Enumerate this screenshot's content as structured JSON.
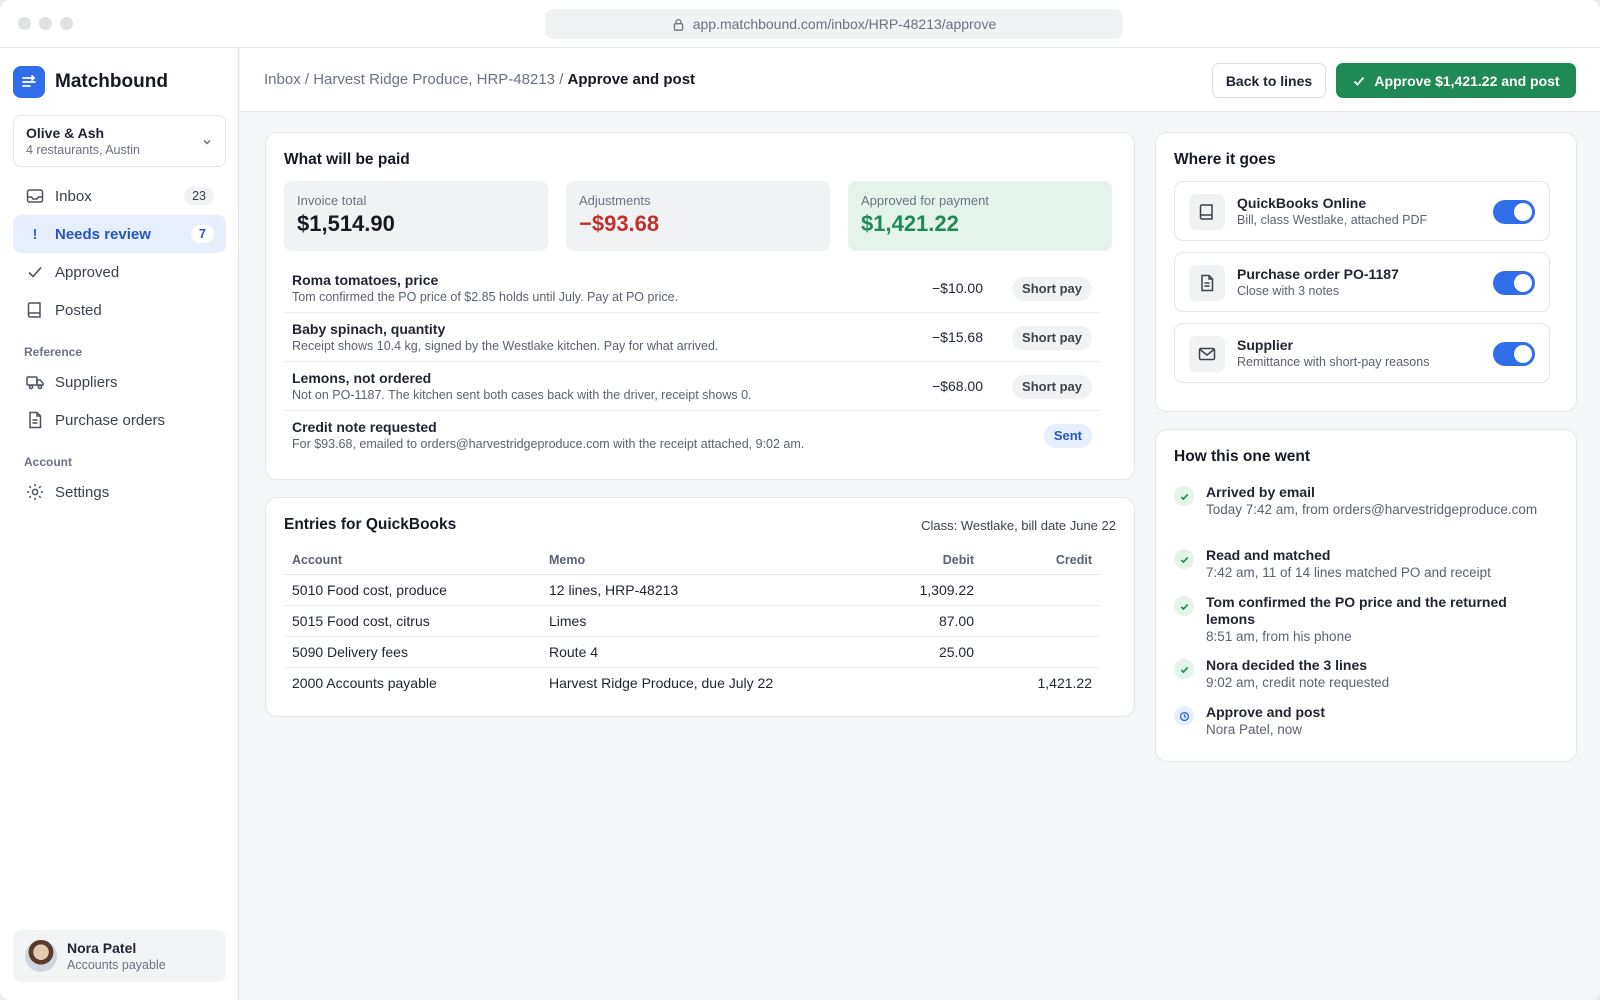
{
  "browser": {
    "url": "app.matchbound.com/inbox/HRP-48213/approve"
  },
  "app": {
    "name": "Matchbound"
  },
  "org": {
    "name": "Olive & Ash",
    "sub": "4 restaurants, Austin"
  },
  "nav": {
    "inbox": {
      "label": "Inbox",
      "count": "23"
    },
    "needs_review": {
      "label": "Needs review",
      "count": "7"
    },
    "approved": {
      "label": "Approved"
    },
    "posted": {
      "label": "Posted"
    },
    "reference_heading": "Reference",
    "suppliers": {
      "label": "Suppliers"
    },
    "purchase_orders": {
      "label": "Purchase orders"
    },
    "account_heading": "Account",
    "settings": {
      "label": "Settings"
    }
  },
  "user": {
    "name": "Nora Patel",
    "role": "Accounts payable"
  },
  "header": {
    "crumb_1": "Inbox",
    "sep": "/",
    "crumb_2": "Harvest Ridge Produce, HRP-48213",
    "crumb_3": "Approve and post",
    "back_label": "Back to lines",
    "approve_label": "Approve $1,421.22 and post"
  },
  "paid": {
    "title": "What will be paid",
    "invoice_total": {
      "label": "Invoice total",
      "value": "$1,514.90"
    },
    "adjustments": {
      "label": "Adjustments",
      "value": "−$93.68"
    },
    "approved": {
      "label": "Approved for payment",
      "value": "$1,421.22"
    },
    "lines": [
      {
        "title": "Roma tomatoes, price",
        "desc": "Tom confirmed the PO price of $2.85 holds until July. Pay at PO price.",
        "amount": "−$10.00",
        "tag": "Short pay"
      },
      {
        "title": "Baby spinach, quantity",
        "desc": "Receipt shows 10.4 kg, signed by the Westlake kitchen. Pay for what arrived.",
        "amount": "−$15.68",
        "tag": "Short pay"
      },
      {
        "title": "Lemons, not ordered",
        "desc": "Not on PO-1187. The kitchen sent both cases back with the driver, receipt shows 0.",
        "amount": "−$68.00",
        "tag": "Short pay"
      },
      {
        "title": "Credit note requested",
        "desc": "For $93.68, emailed to orders@harvestridgeproduce.com with the receipt attached, 9:02 am.",
        "amount": "",
        "tag": "Sent"
      }
    ]
  },
  "entries": {
    "title": "Entries for QuickBooks",
    "meta": "Class: Westlake, bill date June 22",
    "columns": [
      "Account",
      "Memo",
      "Debit",
      "Credit"
    ],
    "rows": [
      [
        "5010 Food cost, produce",
        "12 lines, HRP-48213",
        "1,309.22",
        ""
      ],
      [
        "5015 Food cost, citrus",
        "Limes",
        "87.00",
        ""
      ],
      [
        "5090 Delivery fees",
        "Route 4",
        "25.00",
        ""
      ],
      [
        "2000 Accounts payable",
        "Harvest Ridge Produce, due July 22",
        "",
        "1,421.22"
      ]
    ]
  },
  "where": {
    "title": "Where it goes",
    "items": [
      {
        "title": "QuickBooks Online",
        "sub": "Bill, class Westlake, attached PDF",
        "icon": "book-icon",
        "enabled": true
      },
      {
        "title": "Purchase order PO-1187",
        "sub": "Close with 3 notes",
        "icon": "document-icon",
        "enabled": true
      },
      {
        "title": "Supplier",
        "sub": "Remittance with short-pay reasons",
        "icon": "mail-icon",
        "enabled": true
      }
    ]
  },
  "history": {
    "title": "How this one went",
    "steps": [
      {
        "title": "Arrived by email",
        "sub": "Today 7:42 am, from orders@harvestridgeproduce.com",
        "status": "done"
      },
      {
        "title": "Read and matched",
        "sub": "7:42 am, 11 of 14 lines matched PO and receipt",
        "status": "done"
      },
      {
        "title": "Tom confirmed the PO price and the returned lemons",
        "sub": "8:51 am, from his phone",
        "status": "done"
      },
      {
        "title": "Nora decided the 3 lines",
        "sub": "9:02 am, credit note requested",
        "status": "done"
      },
      {
        "title": "Approve and post",
        "sub": "Nora Patel, now",
        "status": "pending"
      }
    ]
  },
  "colors": {
    "accent": "#2f6ee8",
    "success": "#1f8a55",
    "danger": "#c2302a"
  }
}
